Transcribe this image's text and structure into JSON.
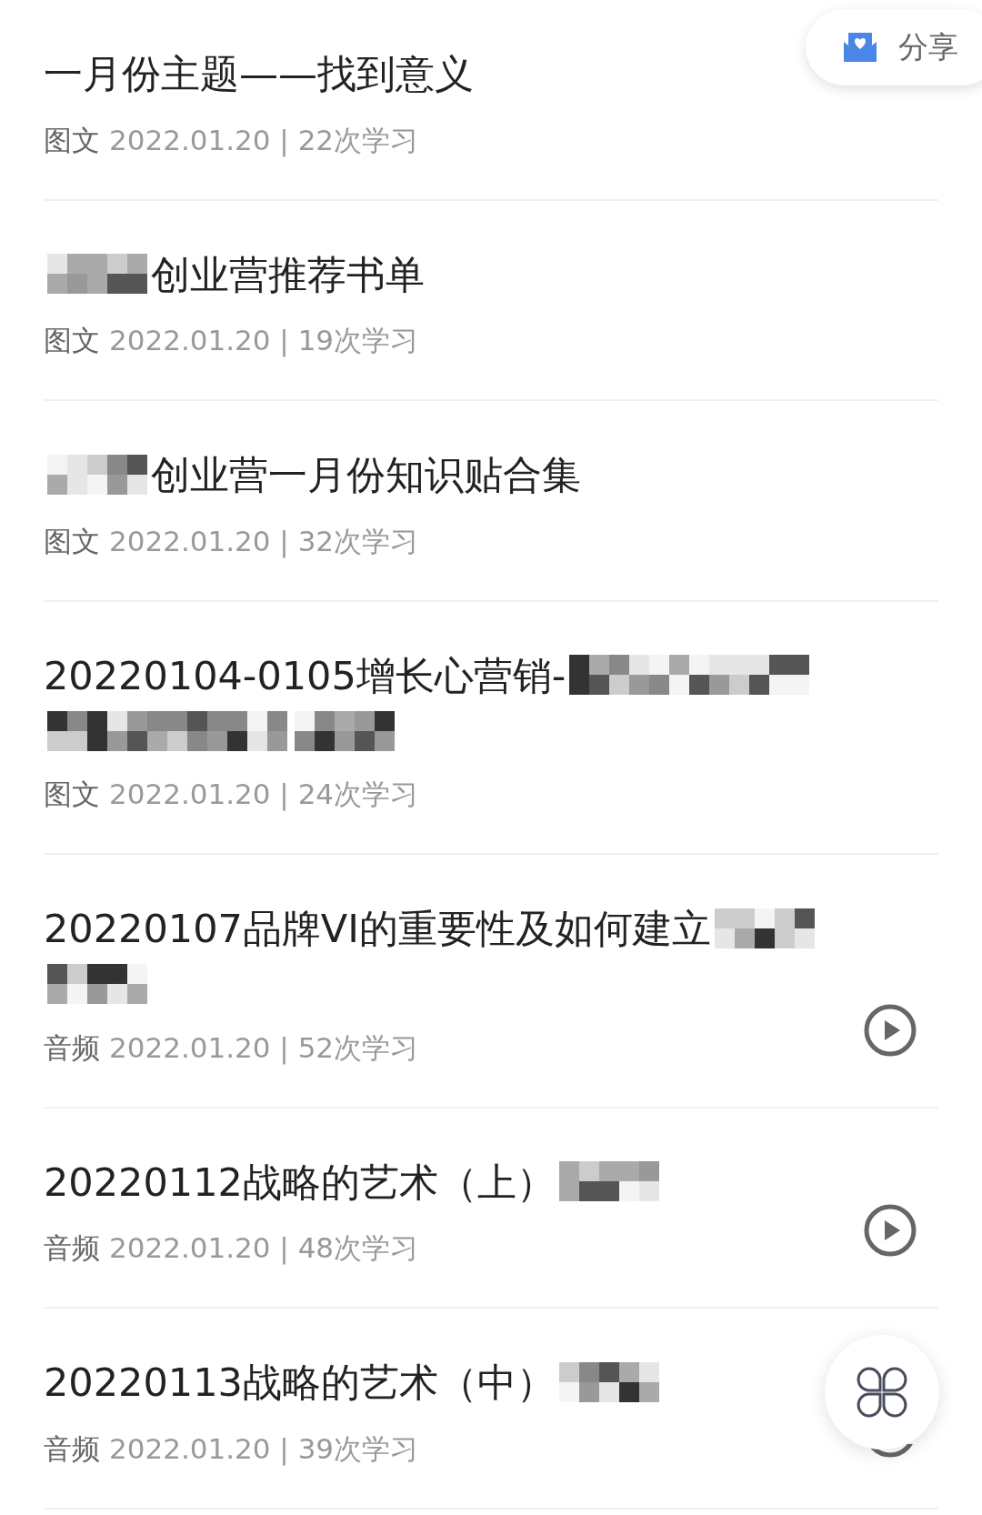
{
  "share_button": {
    "label": "分享"
  },
  "items": [
    {
      "title_parts": [
        {
          "kind": "text",
          "text": "一月份主题——找到意义"
        }
      ],
      "type": "图文",
      "info": "2022.01.20 | 22次学习",
      "playable": false
    },
    {
      "title_parts": [
        {
          "kind": "mosaic"
        },
        {
          "kind": "text",
          "text": "创业营推荐书单"
        }
      ],
      "type": "图文",
      "info": "2022.01.20 | 19次学习",
      "playable": false
    },
    {
      "title_parts": [
        {
          "kind": "mosaic"
        },
        {
          "kind": "text",
          "text": "创业营一月份知识贴合集"
        }
      ],
      "type": "图文",
      "info": "2022.01.20 | 32次学习",
      "playable": false
    },
    {
      "title_parts": [
        {
          "kind": "text",
          "text": "20220104-0105增长心营销-"
        },
        {
          "kind": "mosaic_long"
        },
        {
          "kind": "mosaic_long"
        },
        {
          "kind": "mosaic"
        }
      ],
      "type": "图文",
      "info": "2022.01.20 | 24次学习",
      "playable": false
    },
    {
      "title_parts": [
        {
          "kind": "text",
          "text": "20220107品牌VI的重要性及如何建立"
        },
        {
          "kind": "mosaic"
        },
        {
          "kind": "mosaic"
        }
      ],
      "type": "音频",
      "info": "2022.01.20 | 52次学习",
      "playable": true
    },
    {
      "title_parts": [
        {
          "kind": "text",
          "text": "20220112战略的艺术（上）"
        },
        {
          "kind": "mosaic"
        }
      ],
      "type": "音频",
      "info": "2022.01.20 | 48次学习",
      "playable": true
    },
    {
      "title_parts": [
        {
          "kind": "text",
          "text": "20220113战略的艺术（中）"
        },
        {
          "kind": "mosaic"
        }
      ],
      "type": "音频",
      "info": "2022.01.20 | 39次学习",
      "playable": true
    }
  ]
}
